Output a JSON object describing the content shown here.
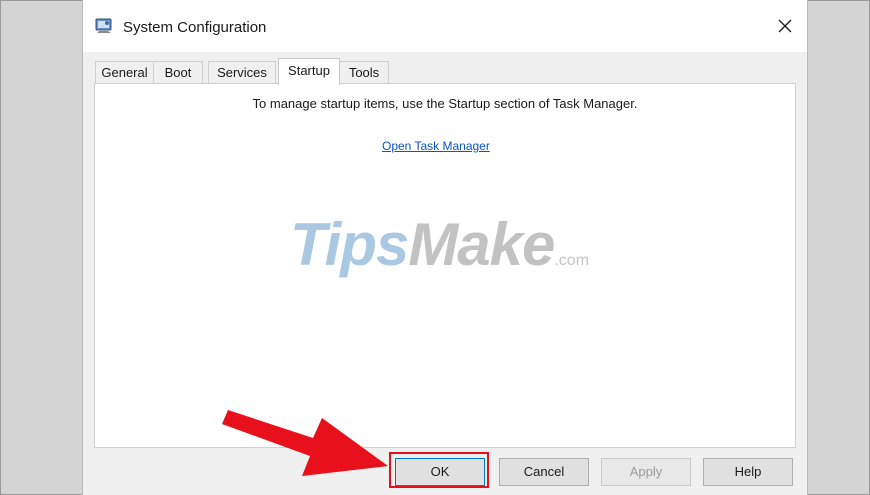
{
  "window": {
    "title": "System Configuration",
    "icon": "msconfig-icon"
  },
  "tabs": [
    {
      "label": "General"
    },
    {
      "label": "Boot"
    },
    {
      "label": "Services"
    },
    {
      "label": "Startup",
      "active": true
    },
    {
      "label": "Tools"
    }
  ],
  "startup": {
    "message": "To manage startup items, use the Startup section of Task Manager.",
    "link_label": "Open Task Manager"
  },
  "watermark": {
    "part1": "Tips",
    "part2": "Make",
    "suffix": ".com"
  },
  "buttons": {
    "ok": "OK",
    "cancel": "Cancel",
    "apply": "Apply",
    "help": "Help"
  },
  "colors": {
    "link": "#0b56c4",
    "highlight": "#e2121b",
    "arrow": "#e8101a",
    "focus_border": "#0078d7"
  },
  "icons": [
    "msconfig-icon",
    "close-icon",
    "arrow-annotation"
  ]
}
